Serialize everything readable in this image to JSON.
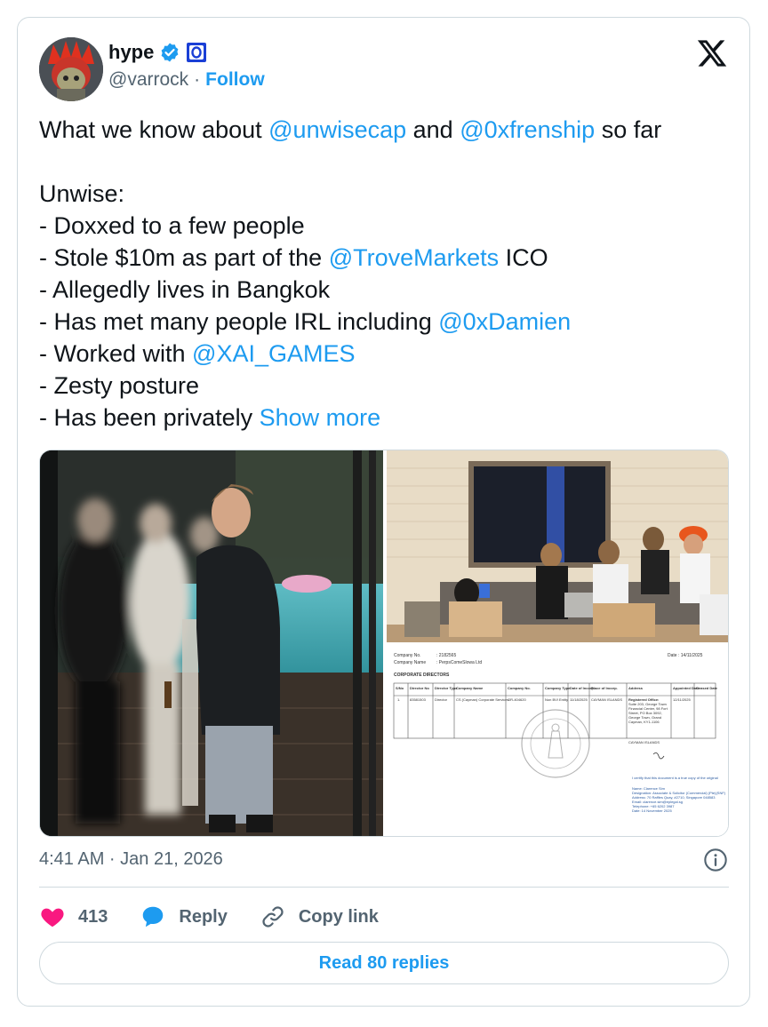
{
  "author": {
    "display_name": "hype",
    "handle": "@varrock",
    "separator": "·",
    "follow_label": "Follow"
  },
  "tweet": {
    "line1": {
      "a": "What we know about ",
      "m1": "@unwisecap",
      "b": " and ",
      "m2": "@0xfrenship",
      "c": " so far"
    },
    "heading": "Unwise:",
    "items": {
      "i1": "- Doxxed to a few people",
      "i2a": "- Stole $10m as part of the ",
      "i2m": "@TroveMarkets",
      "i2b": " ICO",
      "i3": "- Allegedly lives in Bangkok",
      "i4a": "- Has met many people IRL including ",
      "i4m": "@0xDamien",
      "i5a": "- Worked with ",
      "i5m": "@XAI_GAMES",
      "i6": "- Zesty posture",
      "i7a": "- Has been privately ",
      "show_more": "Show more"
    }
  },
  "document": {
    "company_no_label": "Company No.",
    "company_no_value": ": 2182565",
    "company_name_label": "Company Name",
    "company_name_value": ": PerpsComeSlowa Ltd",
    "date_label": "Date",
    "date_value": ": 14/11/2025",
    "section_title": "CORPORATE DIRECTORS",
    "headers": [
      "S/No",
      "Director No",
      "Director Type",
      "Company Name",
      "Company No.",
      "Company Type",
      "Date of Incorp.",
      "Place of Incorp.",
      "Address",
      "Appointed Date",
      "Ceased Date"
    ],
    "row": {
      "sno": "1.",
      "dir_no": "83581503",
      "dir_type": "Director",
      "company_name": "CS (Cayman) Corporate Services",
      "company_no": "OR-404620",
      "company_type": "Non BVI Entity",
      "date_incorp": "11/18/2025",
      "place": "CAYMAN ISLANDS",
      "address_title": "Registered Office:",
      "address_lines": [
        "Suite 203, George Town",
        "Financial Center, 98 Fort",
        "Street, PO Box 3092,",
        "George Town, Grand",
        "Cayman, KY1-1106"
      ],
      "address_country": "CAYMAN ISLANDS",
      "appointed": "12/11/2025"
    },
    "certify_text": "I certify that this document is a true copy of the original",
    "footer_lines": [
      "Name: Clarence Sim",
      "Designation: Associate & Solicitor (Commercial) (Pte)(SNF)",
      "Address: 70 Raffles Quay, #2710, Singapore 048583",
      "Email: clarence.sim@eplegal.sg",
      "Telephone: +65 6202 3987",
      "Date: 14 November 2025"
    ]
  },
  "meta": {
    "timestamp": "4:41 AM · Jan 21, 2026"
  },
  "actions": {
    "like_count": "413",
    "reply_label": "Reply",
    "copy_label": "Copy link",
    "read_replies": "Read 80 replies"
  },
  "colors": {
    "accent": "#1d9bf0",
    "like": "#f91880",
    "muted": "#536471",
    "border": "#cfd9de"
  }
}
